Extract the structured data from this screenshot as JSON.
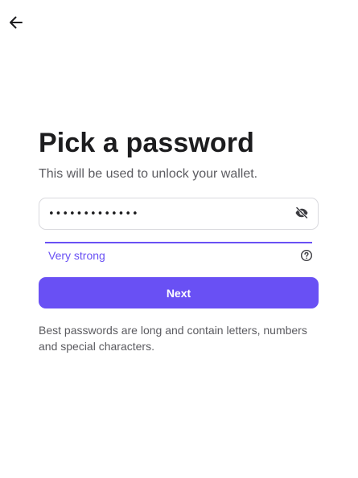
{
  "header": {
    "back_icon": "arrow-left-icon"
  },
  "main": {
    "title": "Pick a password",
    "subtitle": "This will be used to unlock your wallet.",
    "password_field": {
      "value": "•••••••••••••",
      "visibility_icon": "eye-off-icon"
    },
    "strength": {
      "label": "Very strong",
      "level": 1.0,
      "help_icon": "question-circle-icon",
      "color": "#6950f4"
    },
    "next_label": "Next",
    "hint": "Best passwords are long and contain letters, numbers and special characters."
  },
  "colors": {
    "accent": "#6950f4",
    "text_primary": "#1c1c1e",
    "text_secondary": "#5b5b60",
    "border": "#d9d9de"
  }
}
